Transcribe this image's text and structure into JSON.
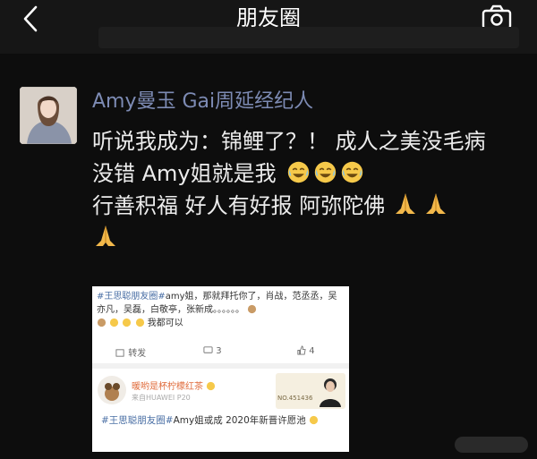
{
  "topbar": {
    "title": "朋友圈",
    "back_icon": "chevron-left-icon",
    "camera_icon": "camera-icon"
  },
  "ghost_text": "",
  "post": {
    "author": "Amy曼玉 Gai周延经纪人",
    "lines": [
      "听说我成为：锦鲤了？！ 成人之美没毛病",
      "没错 Amy姐就是我",
      "行善积福 好人有好报 阿弥陀佛"
    ],
    "emoji_names": [
      "laughing-crying-emoji",
      "praying-hands-emoji"
    ]
  },
  "screenshot": {
    "post_hashtag": "#王思聪朋友圈#",
    "post_text": "amy姐，那就拜托你了，肖战，范丞丞，吴亦凡，吴磊，白敬亭，张新成。。。。。。",
    "post_tail": "我都可以",
    "repost_label": "转发",
    "comment_count": "3",
    "like_count": "4",
    "commenter": "暖哟是杯柠檬红茶",
    "comment_meta": "来自HUAWEI P20",
    "badge_number": "NO.451436",
    "comment_hashtag": "#王思聪朋友圈#",
    "comment_text": "Amy姐或成 2020年新晋许愿池"
  }
}
